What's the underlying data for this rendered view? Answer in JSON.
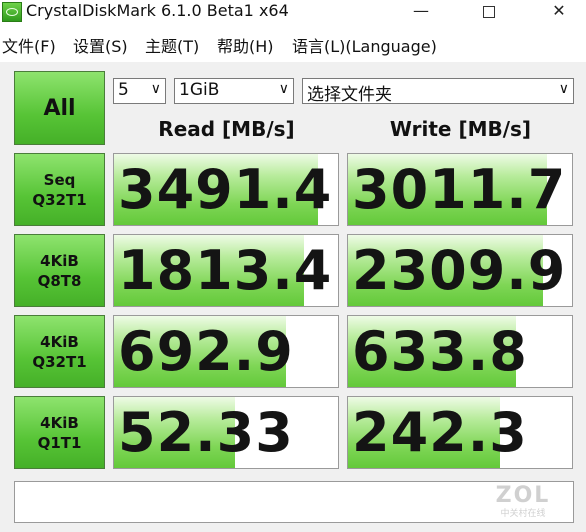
{
  "window": {
    "title": "CrystalDiskMark 6.1.0 Beta1 x64",
    "minimize": "—",
    "close": "✕"
  },
  "menu": [
    "文件(F)",
    "设置(S)",
    "主题(T)",
    "帮助(H)",
    "语言(L)(Language)"
  ],
  "controls": {
    "all_label": "All",
    "count": "5",
    "size": "1GiB",
    "drive": "选择文件夹"
  },
  "columns": {
    "read": "Read [MB/s]",
    "write": "Write [MB/s]"
  },
  "tests": [
    {
      "line1": "Seq",
      "line2": "Q32T1",
      "read": "3491.4",
      "write": "3011.7",
      "read_fill": 0.91,
      "write_fill": 0.89
    },
    {
      "line1": "4KiB",
      "line2": "Q8T8",
      "read": "1813.4",
      "write": "2309.9",
      "read_fill": 0.85,
      "write_fill": 0.87
    },
    {
      "line1": "4KiB",
      "line2": "Q32T1",
      "read": "692.9",
      "write": "633.8",
      "read_fill": 0.77,
      "write_fill": 0.75
    },
    {
      "line1": "4KiB",
      "line2": "Q1T1",
      "read": "52.33",
      "write": "242.3",
      "read_fill": 0.54,
      "write_fill": 0.68
    }
  ],
  "status": "",
  "watermark": {
    "logo": "ZOL",
    "sub": "中关村在线"
  },
  "colors": {
    "button_green": "#57c436",
    "bar_green": "#7fd656",
    "background": "#f0f0f0"
  },
  "icons": [
    "app-disk-icon",
    "minimize-icon",
    "maximize-icon",
    "close-icon",
    "chevron-down-icon"
  ]
}
